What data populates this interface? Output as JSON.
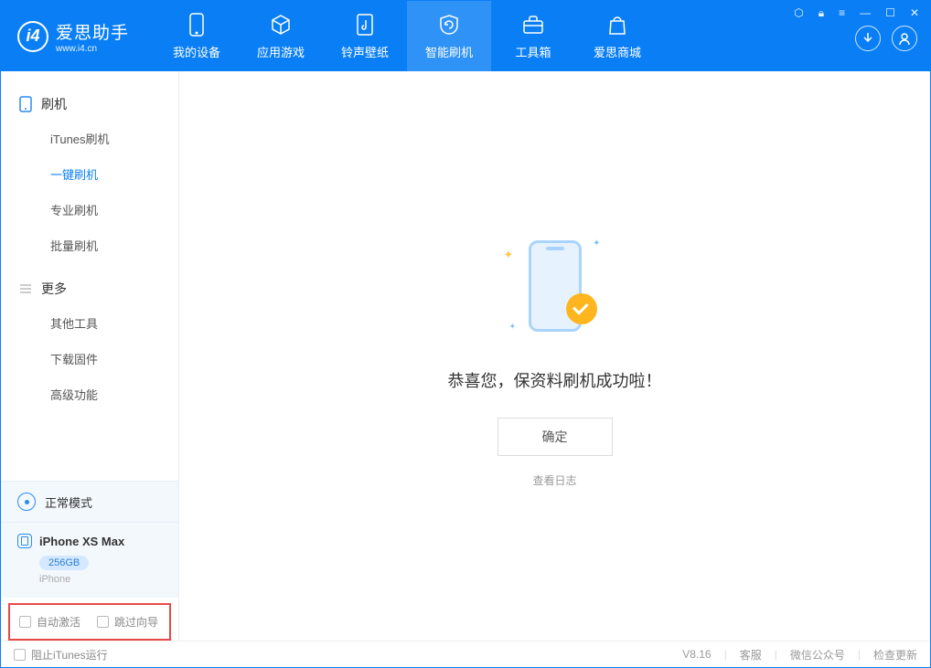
{
  "header": {
    "brand": "爱思助手",
    "brand_url": "www.i4.cn",
    "tabs": [
      {
        "label": "我的设备"
      },
      {
        "label": "应用游戏"
      },
      {
        "label": "铃声壁纸"
      },
      {
        "label": "智能刷机"
      },
      {
        "label": "工具箱"
      },
      {
        "label": "爱思商城"
      }
    ]
  },
  "sidebar": {
    "section1": {
      "title": "刷机",
      "items": [
        "iTunes刷机",
        "一键刷机",
        "专业刷机",
        "批量刷机"
      ]
    },
    "section2": {
      "title": "更多",
      "items": [
        "其他工具",
        "下载固件",
        "高级功能"
      ]
    },
    "mode": "正常模式",
    "device": {
      "name": "iPhone XS Max",
      "storage": "256GB",
      "type": "iPhone"
    },
    "checkboxes": {
      "auto_activate": "自动激活",
      "skip_guide": "跳过向导"
    }
  },
  "main": {
    "success_text": "恭喜您，保资料刷机成功啦！",
    "ok_label": "确定",
    "log_label": "查看日志"
  },
  "statusbar": {
    "block_itunes": "阻止iTunes运行",
    "version": "V8.16",
    "support": "客服",
    "wechat": "微信公众号",
    "update": "检查更新"
  }
}
